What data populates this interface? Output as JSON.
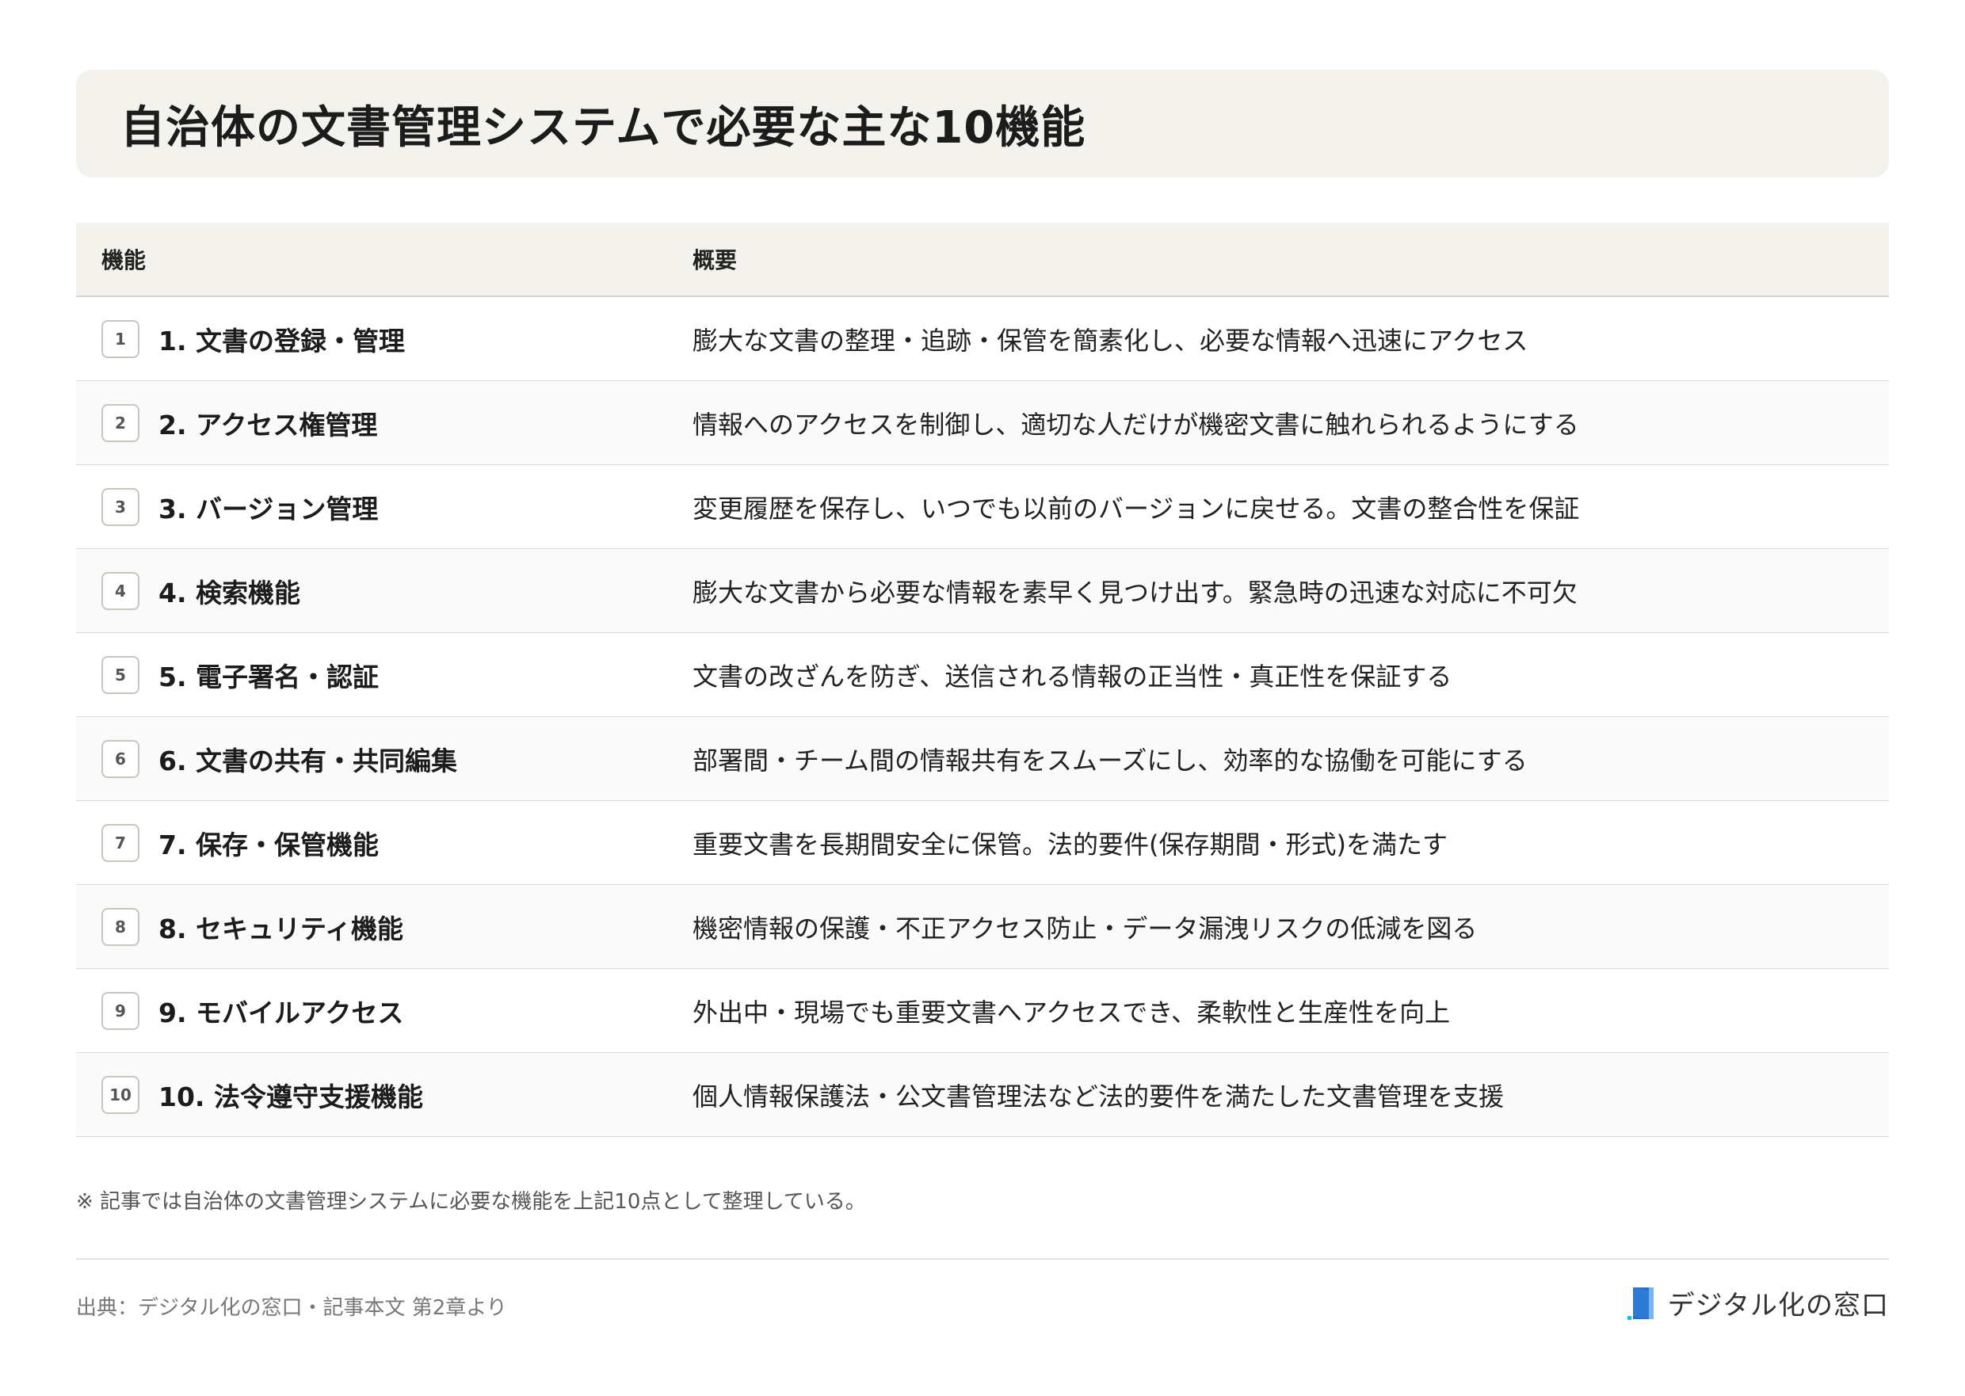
{
  "title": "自治体の文書管理システムで必要な主な10機能",
  "table": {
    "headers": {
      "function": "機能",
      "summary": "概要"
    },
    "rows": [
      {
        "num": "1",
        "function": "1. 文書の登録・管理",
        "summary": "膨大な文書の整理・追跡・保管を簡素化し、必要な情報へ迅速にアクセス"
      },
      {
        "num": "2",
        "function": "2. アクセス権管理",
        "summary": "情報へのアクセスを制御し、適切な人だけが機密文書に触れられるようにする"
      },
      {
        "num": "3",
        "function": "3. バージョン管理",
        "summary": "変更履歴を保存し、いつでも以前のバージョンに戻せる。文書の整合性を保証"
      },
      {
        "num": "4",
        "function": "4. 検索機能",
        "summary": "膨大な文書から必要な情報を素早く見つけ出す。緊急時の迅速な対応に不可欠"
      },
      {
        "num": "5",
        "function": "5. 電子署名・認証",
        "summary": "文書の改ざんを防ぎ、送信される情報の正当性・真正性を保証する"
      },
      {
        "num": "6",
        "function": "6. 文書の共有・共同編集",
        "summary": "部署間・チーム間の情報共有をスムーズにし、効率的な協働を可能にする"
      },
      {
        "num": "7",
        "function": "7. 保存・保管機能",
        "summary": "重要文書を長期間安全に保管。法的要件(保存期間・形式)を満たす"
      },
      {
        "num": "8",
        "function": "8. セキュリティ機能",
        "summary": "機密情報の保護・不正アクセス防止・データ漏洩リスクの低減を図る"
      },
      {
        "num": "9",
        "function": "9. モバイルアクセス",
        "summary": "外出中・現場でも重要文書へアクセスでき、柔軟性と生産性を向上"
      },
      {
        "num": "10",
        "function": "10. 法令遵守支援機能",
        "summary": "個人情報保護法・公文書管理法など法的要件を満たした文書管理を支援"
      }
    ]
  },
  "note": "※ 記事では自治体の文書管理システムに必要な機能を上記10点として整理している。",
  "source": "出典：デジタル化の窓口・記事本文 第2章より",
  "brand": {
    "name": "デジタル化の窓口",
    "icon": "door-logo-icon",
    "color": "#2e7bd6"
  }
}
